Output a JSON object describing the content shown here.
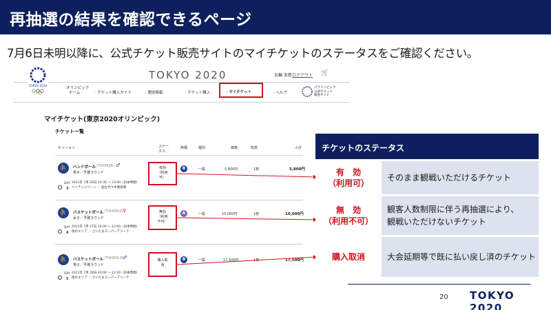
{
  "slide": {
    "title": "再抽選の結果を確認できるページ",
    "subtitle": "7月6日未明以降に、公式チケット販売サイトのマイチケットのステータスをご確認ください。"
  },
  "site": {
    "emblem_text": "TOKYO 2020",
    "brand": "TOKYO 2020",
    "user_name": "五輪 太郎",
    "logout_label": "ログアウト",
    "nav": [
      {
        "label_1": "オリンピック",
        "label_2": "ホーム"
      },
      {
        "label_1": "チケット購入ガイド",
        "label_2": ""
      },
      {
        "label_1": "競技情報",
        "label_2": ""
      },
      {
        "label_1": "チケット購入",
        "label_2": ""
      },
      {
        "label_1": "マイチケット",
        "label_2": ""
      },
      {
        "label_1": "ヘルプ",
        "label_2": ""
      }
    ],
    "paralympic_text_1": "パラリンピック",
    "paralympic_text_2": "公式チケット",
    "paralympic_text_3": "販売サイト",
    "page_title": "マイチケット(東京2020オリンピック)",
    "list_title": "チケット一覧",
    "columns": {
      "session": "セッション",
      "status_1": "ステー",
      "status_2": "タス：",
      "seat": "席種",
      "type": "種別",
      "price": "価格",
      "qty": "枚数",
      "subtotal": "小計"
    },
    "rows": [
      {
        "event": "ハンドボール",
        "code": "(TOH00JR)",
        "sub": "男子／予選ラウンド",
        "day_label": "DAY",
        "day_num": "3",
        "date": "2021年 7月 26日 10:30 ～ 23:00（日本時間）",
        "venue": "ヘリテッジゾーン ｜ 国立代々木競技場",
        "status_1": "有効",
        "status_2": "（利用",
        "status_3": "可）",
        "seat": "B",
        "seat_color": "#1d3f8f",
        "type": "一般",
        "price": "5,800円",
        "qty": "1枚",
        "subtotal": "5,800円"
      },
      {
        "event": "バスケットボール",
        "code": "(TOH00KX)",
        "sub": "女子／予選ラウンド",
        "day_label": "DAY",
        "day_num": "4",
        "date": "2021年 7月 27日 10:00 ～ 12:00（日本時間）",
        "venue": "他のエリア ｜ さいたまスーパーアリーナ",
        "status_1": "無効",
        "status_2": "（利用",
        "status_3": "不可）",
        "seat": "A",
        "seat_color": "#7b5ea8",
        "type": "一般",
        "price": "10,000円",
        "qty": "1枚",
        "subtotal": "10,000円"
      },
      {
        "event": "バスケットボール",
        "code": "(TOH0OL3)",
        "sub": "男子／予選ラウンド",
        "day_label": "DAY",
        "day_num": "5",
        "date": "2021年 7月 28日 10:00 ～ 12:00（日本時間）",
        "venue": "他のエリア ｜ さいたまスーパーアリーナ",
        "status_1": "購入取",
        "status_2": "消",
        "status_3": "",
        "seat": "B",
        "seat_color": "#1d3f8f",
        "type": "一般",
        "price": "17,500円",
        "qty": "1枚",
        "subtotal": "17,500円"
      }
    ]
  },
  "legend": {
    "title": "チケットのステータス",
    "rows": [
      {
        "key_1": "有　効",
        "key_2": "（利用可）",
        "desc_1": "そのまま観戦いただけるチケット",
        "desc_2": ""
      },
      {
        "key_1": "無　効",
        "key_2": "（利用不可）",
        "desc_1": "観客人数制限に伴う再抽選により、",
        "desc_2": "観戦いただけないチケット"
      },
      {
        "key_1": "購入取消",
        "key_2": "",
        "desc_1": "大会延期等で既に払い戻し済のチケット",
        "desc_2": ""
      }
    ]
  },
  "footer": {
    "page_number": "20",
    "brand": "TOKYO 2020"
  },
  "colors": {
    "header_navy": "#0d1f5c",
    "highlight_red": "#d0111b",
    "legend_fill": "#dde2ef"
  }
}
